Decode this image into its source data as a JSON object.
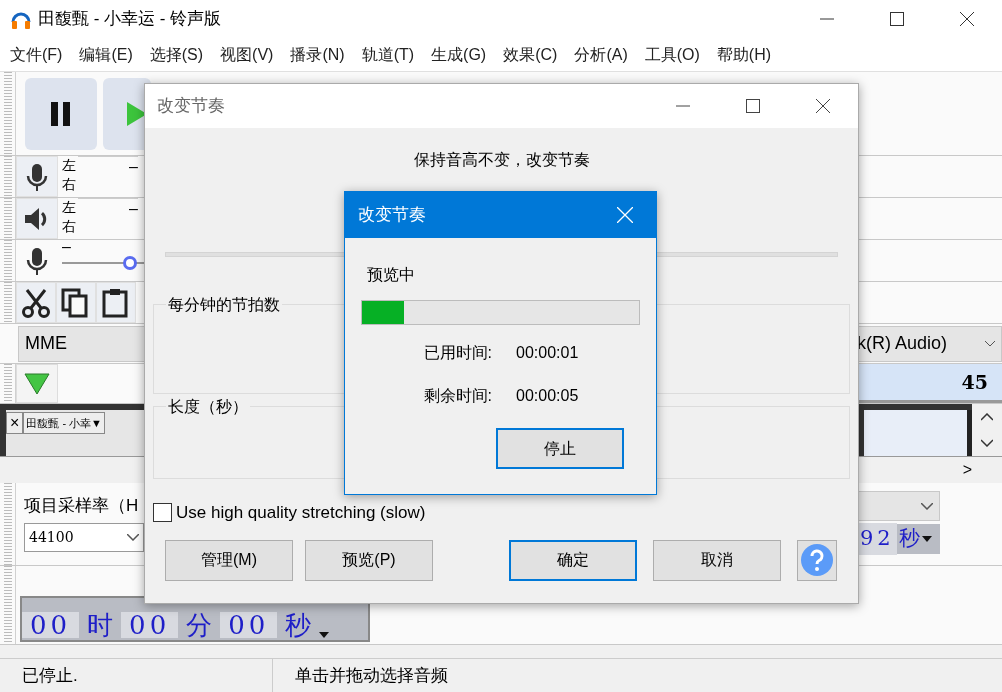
{
  "window": {
    "title": "田馥甄 - 小幸运 - 铃声版"
  },
  "menu": [
    "文件(F)",
    "编辑(E)",
    "选择(S)",
    "视图(V)",
    "播录(N)",
    "轨道(T)",
    "生成(G)",
    "效果(C)",
    "分析(A)",
    "工具(O)",
    "帮助(H)"
  ],
  "meters": [
    {
      "kind": "record",
      "labels": [
        "左",
        "右"
      ],
      "reading": "–"
    },
    {
      "kind": "playback",
      "labels": [
        "左",
        "右"
      ],
      "reading": "–"
    }
  ],
  "input_slider": {
    "label": "–",
    "level": 0.5
  },
  "device_bar": {
    "host": "MME",
    "device": "k(R) Audio)"
  },
  "ruler": {
    "label": "45"
  },
  "track": {
    "close": "×",
    "name": "田馥甄 - 小幸▼"
  },
  "scroll": {
    "right": ">"
  },
  "selection_bar": {
    "rate_label": "项目采样率（H",
    "rate_value": "44100",
    "time_tail": [
      "92",
      "秒"
    ]
  },
  "time_display": [
    "00",
    "时",
    "00",
    "分",
    "00",
    "秒"
  ],
  "status_bar": [
    "已停止.",
    "单击并拖动选择音频"
  ],
  "dialog": {
    "title": "改变节奏",
    "heading": "保持音高不变，改变节奏",
    "groups": [
      "每分钟的节拍数",
      "长度（秒）"
    ],
    "checkbox": {
      "label": "Use high quality stretching (slow)",
      "checked": false
    },
    "buttons": [
      {
        "label": "管理(M)",
        "focused": false
      },
      {
        "label": "预览(P)",
        "focused": false
      },
      {
        "label": "确定",
        "focused": true
      },
      {
        "label": "取消",
        "focused": false
      }
    ]
  },
  "progress": {
    "title": "改变节奏",
    "status": "预览中",
    "level": 0.15,
    "rows": [
      {
        "label": "已用时间:",
        "value": "00:00:01"
      },
      {
        "label": "剩余时间:",
        "value": "00:00:05"
      }
    ],
    "button": {
      "label": "停止",
      "focused": true
    }
  }
}
